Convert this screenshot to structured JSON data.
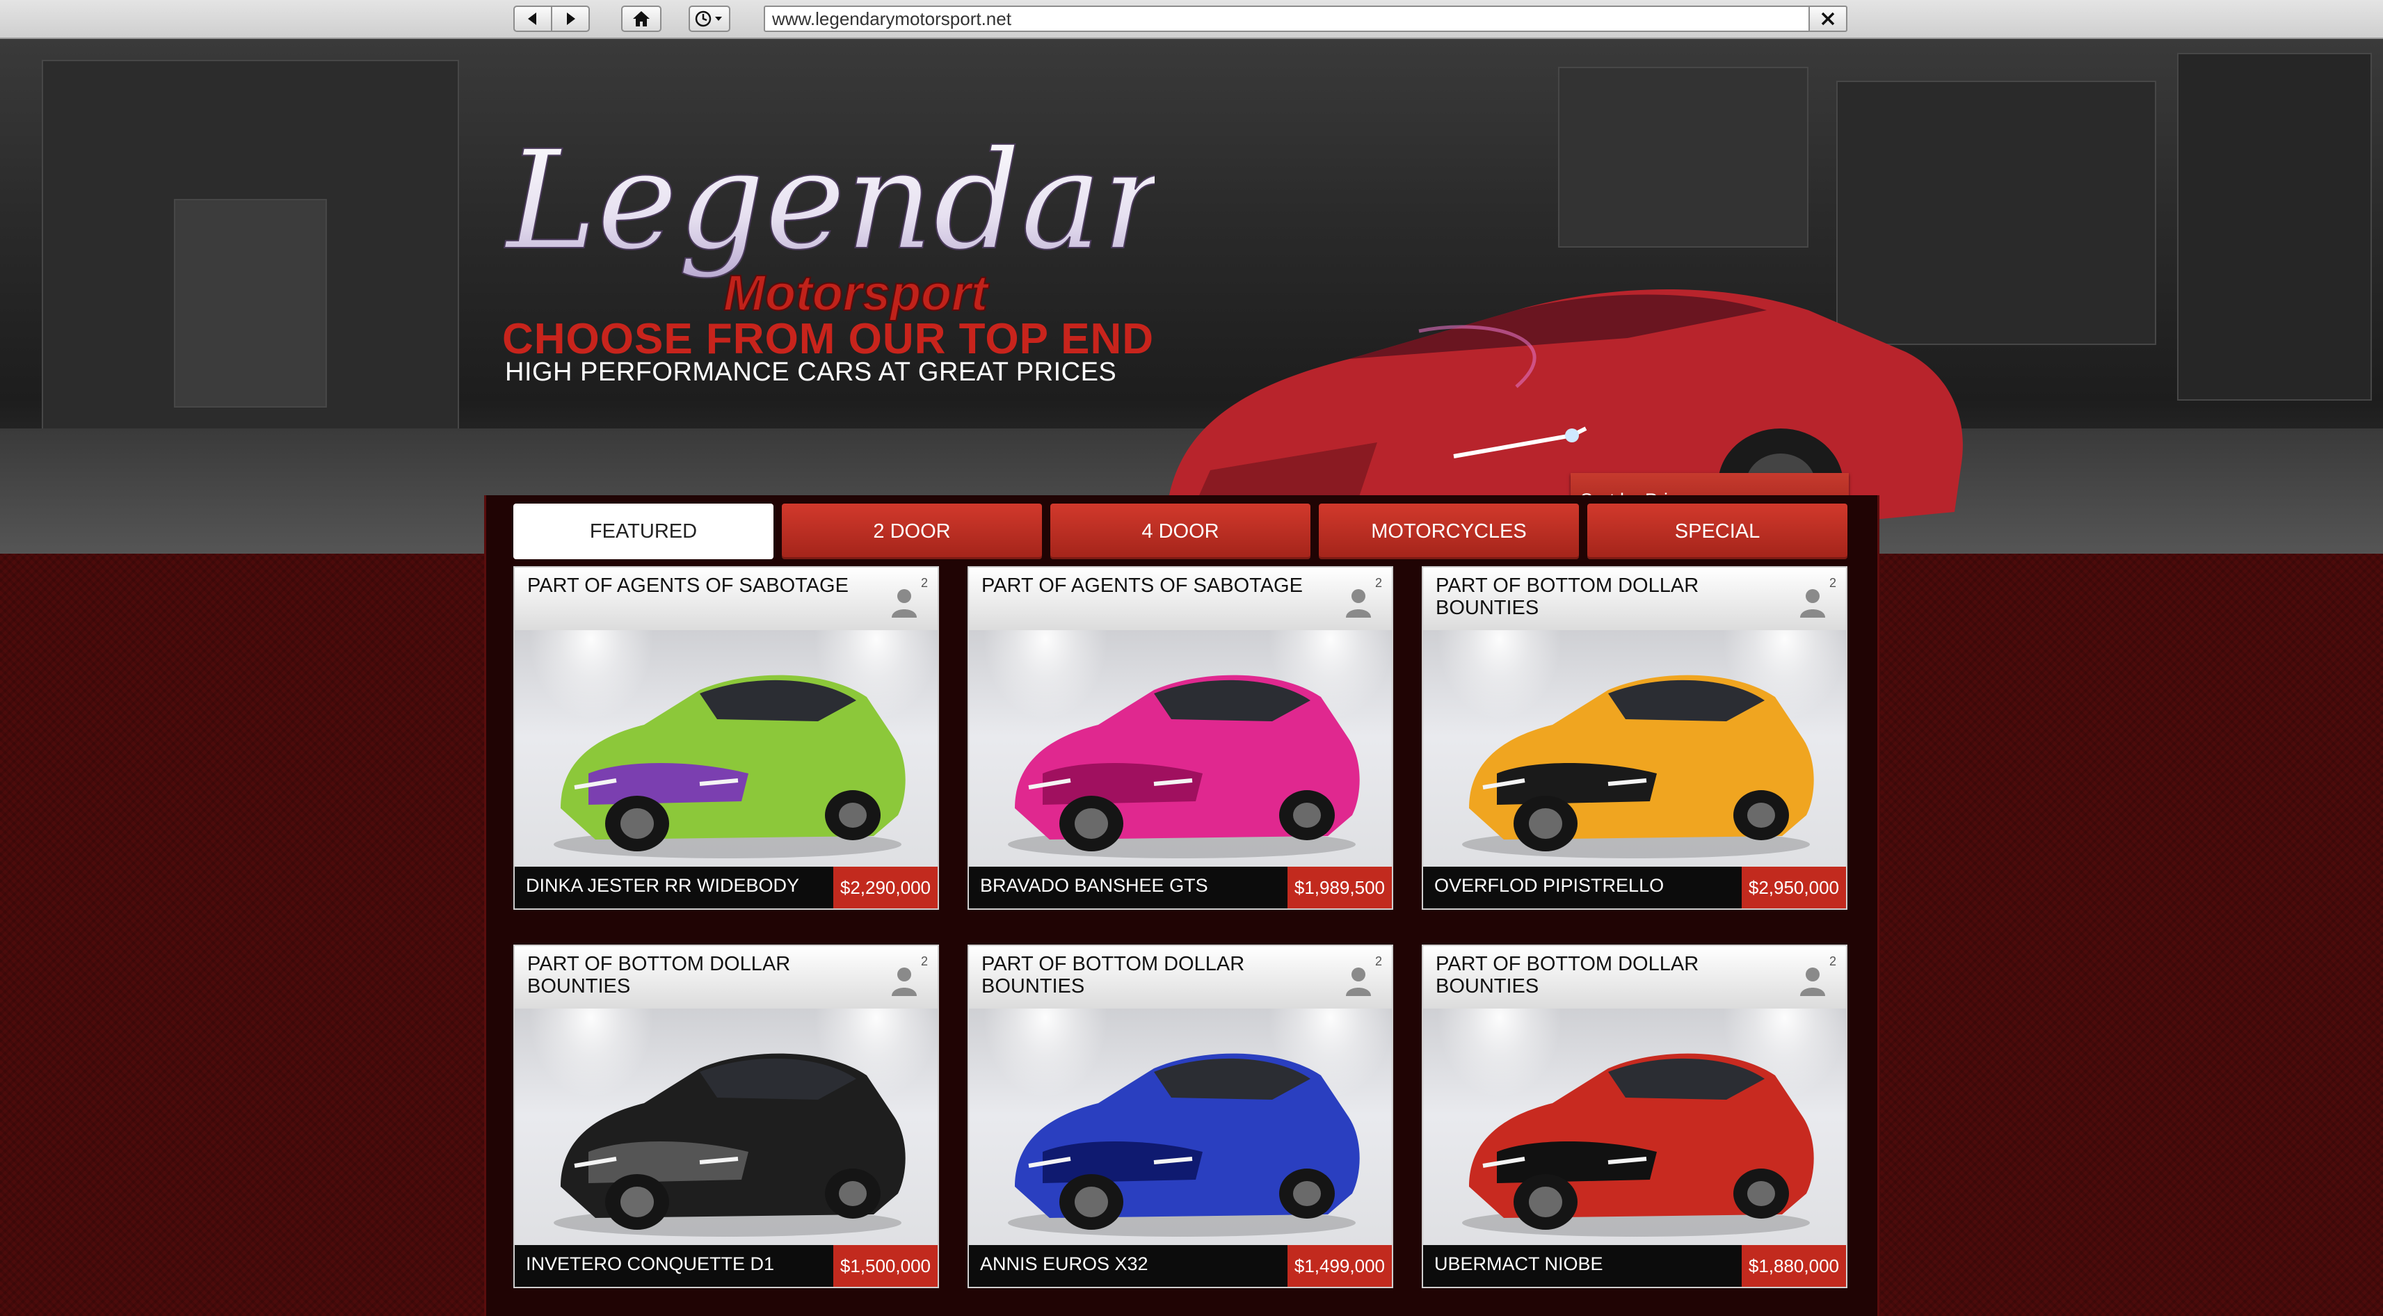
{
  "browser": {
    "url": "www.legendarymotorsport.net",
    "icons": [
      "back-arrow-icon",
      "forward-arrow-icon",
      "home-icon",
      "history-clock-icon",
      "close-x-icon"
    ]
  },
  "hero": {
    "logo_script": "Legendary",
    "logo_sub": "Motorsport",
    "tagline_1": "CHOOSE FROM OUR TOP END",
    "tagline_2": "HIGH PERFORMANCE CARS AT GREAT PRICES"
  },
  "sort": {
    "label": "Sort by Price"
  },
  "tabs": [
    {
      "label": "FEATURED",
      "active": true
    },
    {
      "label": "2 DOOR",
      "active": false
    },
    {
      "label": "4 DOOR",
      "active": false
    },
    {
      "label": "MOTORCYCLES",
      "active": false
    },
    {
      "label": "SPECIAL",
      "active": false
    }
  ],
  "cards": [
    {
      "category": "PART OF AGENTS OF SABOTAGE",
      "players": "2",
      "name": "DINKA JESTER RR WIDEBODY",
      "price": "$2,290,000",
      "car_color": "#8cc83a",
      "accent": "#7b3fb0"
    },
    {
      "category": "PART OF AGENTS OF SABOTAGE",
      "players": "2",
      "name": "BRAVADO BANSHEE GTS",
      "price": "$1,989,500",
      "car_color": "#e0288f",
      "accent": "#a0105f"
    },
    {
      "category": "PART OF BOTTOM DOLLAR BOUNTIES",
      "players": "2",
      "name": "OVERFLOD PIPISTRELLO",
      "price": "$2,950,000",
      "car_color": "#f0a520",
      "accent": "#1a1a1a"
    },
    {
      "category": "PART OF BOTTOM DOLLAR BOUNTIES",
      "players": "2",
      "name": "INVETERO CONQUETTE D1",
      "price": "$1,500,000",
      "car_color": "#1e1e1e",
      "accent": "#555555"
    },
    {
      "category": "PART OF BOTTOM DOLLAR BOUNTIES",
      "players": "2",
      "name": "ANNIS EUROS X32",
      "price": "$1,499,000",
      "car_color": "#2a3fc0",
      "accent": "#0f1a70"
    },
    {
      "category": "PART OF BOTTOM DOLLAR BOUNTIES",
      "players": "2",
      "name": "UBERMACT NIOBE",
      "price": "$1,880,000",
      "car_color": "#c82a20",
      "accent": "#111111"
    }
  ]
}
